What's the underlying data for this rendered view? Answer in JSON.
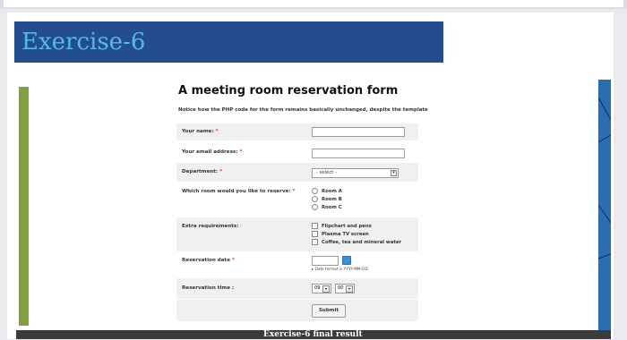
{
  "slide": {
    "title": "Exercise-6",
    "footer_text": "Exercise-6 final result"
  },
  "form": {
    "title": "A meeting room reservation form",
    "note": "Notice how the PHP code for the form remains basically unchanged, despite the template",
    "required_marker": "*",
    "fields": {
      "name_label": "Your name:",
      "email_label": "Your email address:",
      "department_label": "Department:",
      "department_selected": "- select -",
      "room_label": "Which room would you like to reserve:",
      "rooms": [
        "Room A",
        "Room B",
        "Room C"
      ],
      "extras_label": "Extra requirements:",
      "extras": [
        "Flipchart and pens",
        "Plasma TV screen",
        "Coffee, tea and mineral water"
      ],
      "date_label": "Reservation date",
      "date_hint": "Date format is YYYY-MM-DD",
      "time_label": "Reservation time :",
      "hour_selected": "09",
      "minute_selected": "00",
      "submit_label": "Submit"
    }
  },
  "colors": {
    "banner": "#234d8e",
    "banner_text": "#56b6ef",
    "left_accent": "#82a040",
    "right_accent": "#2c6db0",
    "required": "#e0321d"
  }
}
